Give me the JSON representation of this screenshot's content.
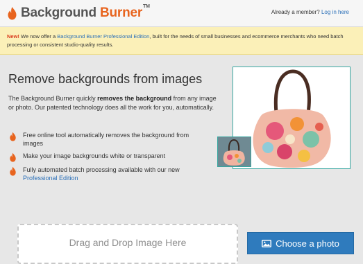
{
  "header": {
    "logo_word1": "Background",
    "logo_word2": "Burner",
    "logo_tm": "TM",
    "member_text": "Already a member?",
    "login_link": "Log in here"
  },
  "notice": {
    "new_label": "New!",
    "text_before": "We now offer a",
    "link_text": "Background Burner Professional Edition",
    "text_after": ", built for the needs of small businesses and ecommerce merchants who need batch processing or consistent studio-quality results."
  },
  "main": {
    "headline": "Remove backgrounds from images",
    "intro_before": "The Background Burner quickly",
    "intro_bold": "removes the background",
    "intro_after": "from any image or photo. Our patented technology does all the work for you, automatically.",
    "features": [
      {
        "text": "Free online tool automatically removes the background from images"
      },
      {
        "text": "Make your image backgrounds white or transparent"
      },
      {
        "text": "Fully automated batch processing available with our new",
        "link": "Professional Edition"
      }
    ]
  },
  "upload": {
    "drop_text": "Drag and Drop Image Here",
    "choose_label": "Choose a photo"
  },
  "icons": {
    "logo": "flame-icon",
    "bullet": "flame-icon",
    "button": "image-icon"
  },
  "colors": {
    "brand_orange": "#e8641e",
    "link_blue": "#2a6fb8",
    "button_blue": "#2f7bbd",
    "notice_bg": "#fbf0b8",
    "image_border": "#37a7a0"
  }
}
